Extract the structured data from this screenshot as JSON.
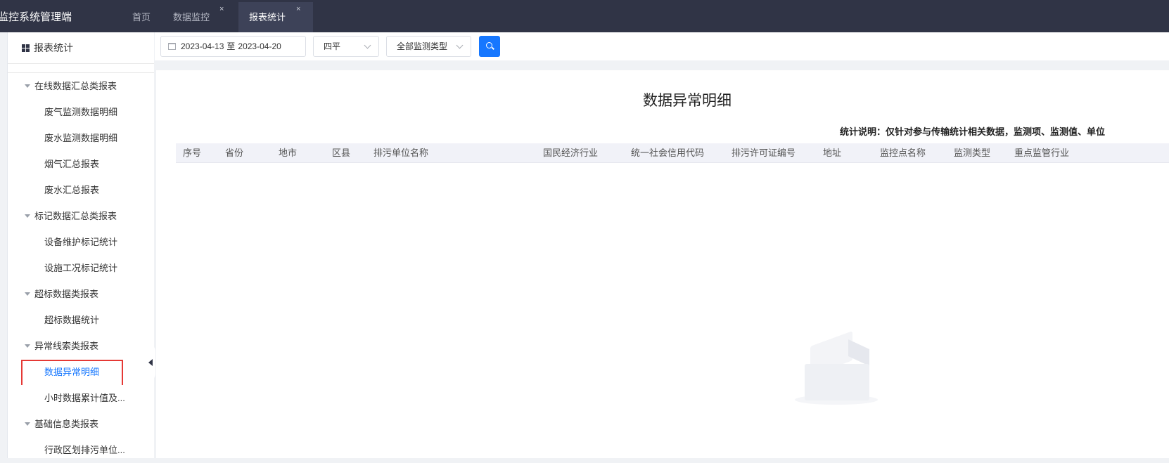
{
  "app": {
    "title": "动监控系统管理端"
  },
  "tabs": [
    {
      "label": "首页"
    },
    {
      "label": "数据监控",
      "close": "×"
    },
    {
      "label": "报表统计",
      "close": "×"
    }
  ],
  "sidebar": {
    "header": "报表统计",
    "groups": [
      {
        "label": "在线数据汇总类报表",
        "items": [
          "废气监测数据明细",
          "废水监测数据明细",
          "烟气汇总报表",
          "废水汇总报表"
        ]
      },
      {
        "label": "标记数据汇总类报表",
        "items": [
          "设备维护标记统计",
          "设施工况标记统计"
        ]
      },
      {
        "label": "超标数据类报表",
        "items": [
          "超标数据统计"
        ]
      },
      {
        "label": "异常线索类报表",
        "items": [
          "数据异常明细",
          "小时数据累计值及..."
        ]
      },
      {
        "label": "基础信息类报表",
        "items": [
          "行政区划排污单位..."
        ]
      }
    ]
  },
  "filters": {
    "date_start": "2023-04-13",
    "date_sep": "至",
    "date_end": "2023-04-20",
    "region": "四平",
    "monitor_type": "全部监测类型"
  },
  "report": {
    "title": "数据异常明细",
    "note": "统计说明：仅针对参与传输统计相关数据，监测项、监测值、单位",
    "columns": [
      "序号",
      "省份",
      "地市",
      "区县",
      "排污单位名称",
      "国民经济行业",
      "统一社会信用代码",
      "排污许可证编号",
      "地址",
      "监控点名称",
      "监测类型",
      "重点监管行业"
    ]
  }
}
